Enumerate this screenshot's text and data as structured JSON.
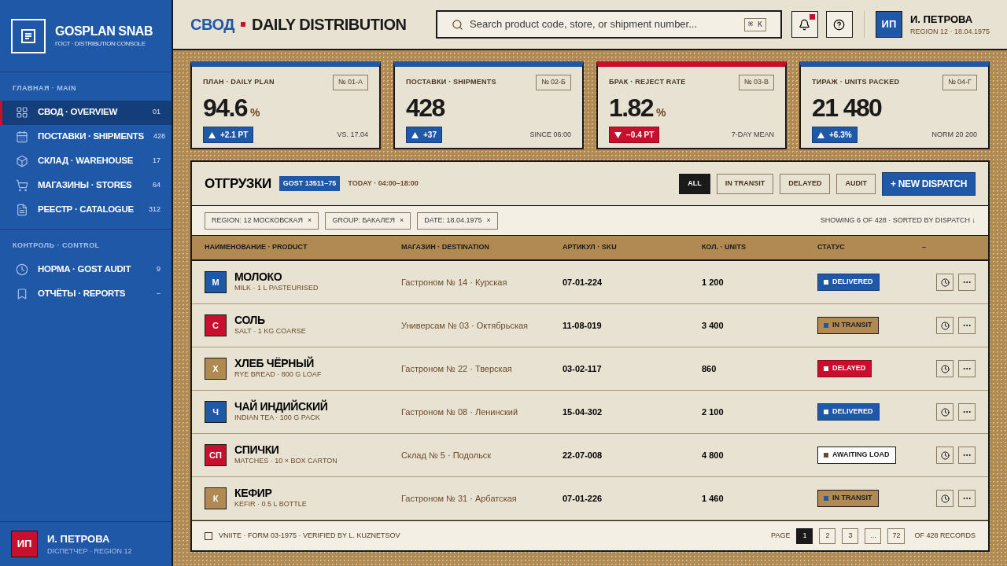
{
  "brand": {
    "title": "GOSPLAN SNAB",
    "subtitle": "ГОСТ · DISTRIBUTION CONSOLE"
  },
  "sidebar": {
    "sections": [
      {
        "heading": "ГЛАВНАЯ · MAIN",
        "items": [
          {
            "label": "СВОД · OVERVIEW",
            "count": "01",
            "kind": "grid",
            "selected": true
          },
          {
            "label": "ПОСТАВКИ · SHIPMENTS",
            "count": "428",
            "kind": "calendar",
            "selected": false
          },
          {
            "label": "СКЛАД · WAREHOUSE",
            "count": "17",
            "kind": "box",
            "selected": false
          },
          {
            "label": "МАГАЗИНЫ · STORES",
            "count": "64",
            "kind": "cart",
            "selected": false
          },
          {
            "label": "РЕЕСТР · CATALOGUE",
            "count": "312",
            "kind": "doc",
            "selected": false
          }
        ]
      },
      {
        "heading": "КОНТРОЛЬ · CONTROL",
        "items": [
          {
            "label": "НОРМА · GOST AUDIT",
            "count": "9",
            "kind": "clock",
            "selected": false
          },
          {
            "label": "ОТЧЁТЫ · REPORTS",
            "count": "–",
            "kind": "bookmark",
            "selected": false
          }
        ]
      }
    ]
  },
  "sidebar_user": {
    "initials": "ИП",
    "name": "И. ПЕТРОВА",
    "role": "DIСПЕТЧЕР · REGION 12"
  },
  "header": {
    "title_ru": "СВОД",
    "title_en": "DAILY DISTRIBUTION",
    "search": {
      "placeholder": "Search product code, store, or shipment number...",
      "shortcut": "⌘ K"
    },
    "notifications_unread": true,
    "user": {
      "initials": "ИП",
      "name": "И. ПЕТРОВА",
      "meta": "REGION 12 · 18.04.1975"
    }
  },
  "kpis": [
    {
      "label": "ПЛАН · DAILY PLAN",
      "code": "№ 01-А",
      "value": "94.6",
      "unit": "%",
      "delta": "+2.1 PT",
      "kind": "up",
      "note": "VS. 17.04"
    },
    {
      "label": "ПОСТАВКИ · SHIPMENTS",
      "code": "№ 02-Б",
      "value": "428",
      "delta": "+37",
      "kind": "up",
      "note": "SINCE 06:00"
    },
    {
      "label": "БРАК · REJECT RATE",
      "code": "№ 03-В",
      "value": "1.82",
      "unit": "%",
      "delta": "−0.4 PT",
      "kind": "down",
      "note": "7-DAY MEAN"
    },
    {
      "label": "ТИРАЖ · UNITS PACKED",
      "code": "№ 04-Г",
      "value": "21 480",
      "delta": "+6.3%",
      "kind": "up",
      "note": "NORM 20 200"
    }
  ],
  "shipments": {
    "title": "ОТГРУЗКИ",
    "standard": "GOST 13511–75",
    "window": "TODAY · 04:00–18:00",
    "filters": [
      {
        "label": "ALL",
        "selected": true
      },
      {
        "label": "IN TRANSIT",
        "selected": false
      },
      {
        "label": "DELAYED",
        "selected": false
      },
      {
        "label": "AUDIT",
        "selected": false
      }
    ],
    "new_button": "+ NEW DISPATCH",
    "chips": [
      {
        "label": "REGION: 12 МОСКОВСКАЯ",
        "remove": "×"
      },
      {
        "label": "GROUP: БАКАЛЕЯ",
        "remove": "×"
      },
      {
        "label": "DATE: 18.04.1975",
        "remove": "×"
      }
    ],
    "summary": "SHOWING 6 OF 428 · SORTED BY DISPATCH ↓",
    "columns": [
      "НАИМЕНОВАНИЕ · PRODUCT",
      "МАГАЗИН · DESTINATION",
      "АРТИКУЛ · SKU",
      "КОЛ. · UNITS",
      "СТАТУС",
      "–"
    ],
    "rows": [
      {
        "initials": "М",
        "color": "#2058a8",
        "name": "МОЛОКО",
        "description": "MILK · 1 L PASTEURISED",
        "destination": "Гастроном № 14 · Курская",
        "sku": "07-01-224",
        "units": "1 200",
        "status": {
          "label": "DELIVERED",
          "kind": "delivered"
        }
      },
      {
        "initials": "С",
        "color": "#c8102e",
        "name": "СОЛЬ",
        "description": "SALT · 1 KG COARSE",
        "destination": "Универсам № 03 · Октябрьская",
        "sku": "11-08-019",
        "units": "3 400",
        "status": {
          "label": "IN TRANSIT",
          "kind": "transit"
        }
      },
      {
        "initials": "Х",
        "color": "#b08a52",
        "name": "ХЛЕБ ЧЁРНЫЙ",
        "description": "RYE BREAD · 800 G LOAF",
        "destination": "Гастроном № 22 · Тверская",
        "sku": "03-02-117",
        "units": "860",
        "status": {
          "label": "DELAYED",
          "kind": "delayed"
        }
      },
      {
        "initials": "Ч",
        "color": "#2058a8",
        "name": "ЧАЙ ИНДИЙСКИЙ",
        "description": "INDIAN TEA · 100 G PACK",
        "destination": "Гастроном № 08 · Ленинский",
        "sku": "15-04-302",
        "units": "2 100",
        "status": {
          "label": "DELIVERED",
          "kind": "delivered"
        }
      },
      {
        "initials": "СП",
        "color": "#c8102e",
        "name": "СПИЧКИ",
        "description": "MATCHES · 10 × BOX CARTON",
        "destination": "Склад № 5 · Подольск",
        "sku": "22-07-008",
        "units": "4 800",
        "status": {
          "label": "AWAITING LOAD",
          "kind": "awaiting"
        }
      },
      {
        "initials": "К",
        "color": "#b08a52",
        "name": "КЕФИР",
        "description": "KEFIR · 0.5 L BOTTLE",
        "destination": "Гастроном № 31 · Арбатская",
        "sku": "07-01-226",
        "units": "1 460",
        "status": {
          "label": "IN TRANSIT",
          "kind": "transit"
        }
      }
    ],
    "footer": {
      "checked": false,
      "note": "VNIITE · FORM 03-1975 · VERIFIED BY L. KUZNETSOV",
      "page_label": "PAGE",
      "pages": [
        {
          "label": "1",
          "selected": true
        },
        {
          "label": "2",
          "selected": false
        },
        {
          "label": "3",
          "selected": false
        },
        {
          "label": "...",
          "selected": false
        },
        {
          "label": "72",
          "selected": false
        }
      ],
      "total": "OF 428 RECORDS"
    }
  }
}
